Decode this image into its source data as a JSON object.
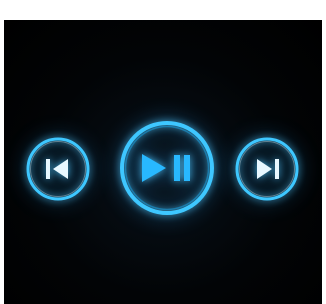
{
  "player": {
    "controls": [
      {
        "name": "previous",
        "icon": "skip-previous-icon"
      },
      {
        "name": "play-pause",
        "icon": "play-pause-icon"
      },
      {
        "name": "next",
        "icon": "skip-next-icon"
      }
    ]
  },
  "colors": {
    "ring": "#3ec7ff",
    "ring_outer": "#1aa6e8",
    "icon_fill": "#e8f8ff",
    "accent_cyan": "#28b8ff",
    "background": "#000000",
    "frame": "#ffffff"
  }
}
